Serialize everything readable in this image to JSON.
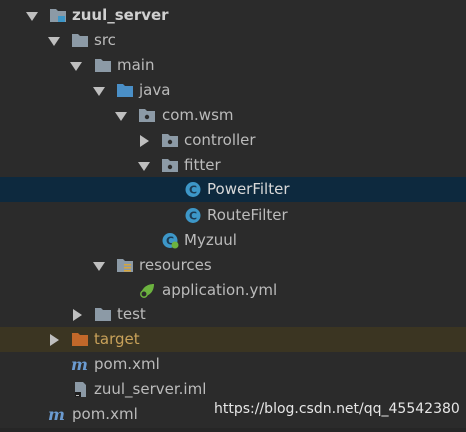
{
  "tree": {
    "items": [
      {
        "label": "zuul_server",
        "icon": "module-folder-icon",
        "expanded": true
      },
      {
        "label": "src",
        "icon": "folder-icon",
        "expanded": true
      },
      {
        "label": "main",
        "icon": "folder-icon",
        "expanded": true
      },
      {
        "label": "java",
        "icon": "source-root-folder-icon",
        "expanded": true
      },
      {
        "label": "com.wsm",
        "icon": "package-icon",
        "expanded": true
      },
      {
        "label": "controller",
        "icon": "package-icon",
        "expanded": false
      },
      {
        "label": "fitter",
        "icon": "package-icon",
        "expanded": true
      },
      {
        "label": "PowerFilter",
        "icon": "java-class-icon",
        "selected": true
      },
      {
        "label": "RouteFilter",
        "icon": "java-class-icon"
      },
      {
        "label": "Myzuul",
        "icon": "spring-boot-class-icon"
      },
      {
        "label": "resources",
        "icon": "resources-folder-icon",
        "expanded": true
      },
      {
        "label": "application.yml",
        "icon": "spring-yml-icon"
      },
      {
        "label": "test",
        "icon": "folder-icon",
        "expanded": false
      },
      {
        "label": "target",
        "icon": "excluded-folder-icon",
        "expanded": false
      },
      {
        "label": "pom.xml",
        "icon": "maven-icon"
      },
      {
        "label": "zuul_server.iml",
        "icon": "iml-file-icon"
      },
      {
        "label": "pom.xml",
        "icon": "maven-icon"
      }
    ]
  },
  "watermark": "https://blog.csdn.net/qq_45542380",
  "colors": {
    "background": "#2b2b2b",
    "selection": "#0d293e",
    "excluded_row": "#3b3522",
    "text": "#bbbbbb",
    "folder": "#8c9aa6",
    "source_folder": "#4a8fc7",
    "excluded_folder": "#c2682a",
    "class_circle": "#3d97c8",
    "maven": "#6b9bd1"
  }
}
